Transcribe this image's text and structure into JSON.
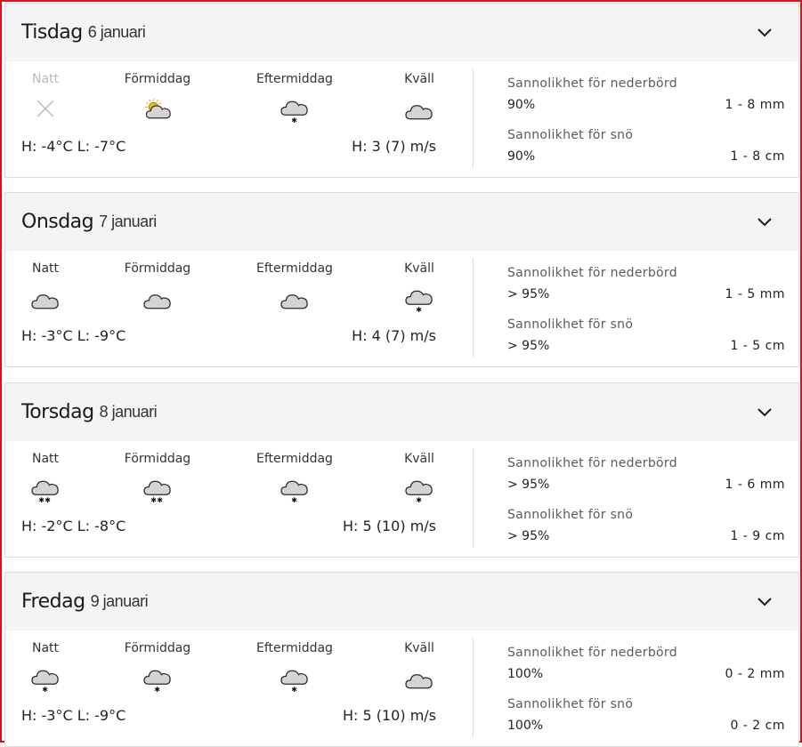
{
  "colors": {
    "frame_border": "#e0101a",
    "header_bg": "#f2f4f5",
    "cloud_fill": "#d4d4d4",
    "cloud_stroke": "#2a2a2a",
    "sun": "#f2b90c"
  },
  "days": [
    {
      "name": "Tisdag",
      "date": "6 januari",
      "periods": [
        {
          "label": "Natt",
          "icon": "unavailable-x-icon",
          "dim": true
        },
        {
          "label": "Förmiddag",
          "icon": "partly-cloudy-icon",
          "dim": false
        },
        {
          "label": "Eftermiddag",
          "icon": "cloud-light-snow-icon",
          "dim": false
        },
        {
          "label": "Kväll",
          "icon": "cloud-icon",
          "dim": false
        }
      ],
      "temps": "H: -4°C L: -7°C",
      "wind": "H: 3 (7) m/s",
      "precip_label": "Sannolikhet för nederbörd",
      "precip_pct": "90%",
      "precip_amt": "1 - 8 mm",
      "snow_label": "Sannolikhet för snö",
      "snow_pct": "90%",
      "snow_amt": "1 - 8 cm"
    },
    {
      "name": "Onsdag",
      "date": "7 januari",
      "periods": [
        {
          "label": "Natt",
          "icon": "cloud-icon",
          "dim": false
        },
        {
          "label": "Förmiddag",
          "icon": "cloud-icon",
          "dim": false
        },
        {
          "label": "Eftermiddag",
          "icon": "cloud-icon",
          "dim": false
        },
        {
          "label": "Kväll",
          "icon": "cloud-light-snow-icon",
          "dim": false
        }
      ],
      "temps": "H: -3°C L: -9°C",
      "wind": "H: 4 (7) m/s",
      "precip_label": "Sannolikhet för nederbörd",
      "precip_pct": "> 95%",
      "precip_amt": "1 - 5 mm",
      "snow_label": "Sannolikhet för snö",
      "snow_pct": "> 95%",
      "snow_amt": "1 - 5 cm"
    },
    {
      "name": "Torsdag",
      "date": "8 januari",
      "periods": [
        {
          "label": "Natt",
          "icon": "cloud-moderate-snow-icon",
          "dim": false
        },
        {
          "label": "Förmiddag",
          "icon": "cloud-moderate-snow-icon",
          "dim": false
        },
        {
          "label": "Eftermiddag",
          "icon": "cloud-light-snow-icon",
          "dim": false
        },
        {
          "label": "Kväll",
          "icon": "cloud-light-snow-icon",
          "dim": false
        }
      ],
      "temps": "H: -2°C L: -8°C",
      "wind": "H: 5 (10) m/s",
      "precip_label": "Sannolikhet för nederbörd",
      "precip_pct": "> 95%",
      "precip_amt": "1 - 6 mm",
      "snow_label": "Sannolikhet för snö",
      "snow_pct": "> 95%",
      "snow_amt": "1 - 9 cm"
    },
    {
      "name": "Fredag",
      "date": "9 januari",
      "periods": [
        {
          "label": "Natt",
          "icon": "cloud-light-snow-icon",
          "dim": false
        },
        {
          "label": "Förmiddag",
          "icon": "cloud-light-snow-icon",
          "dim": false
        },
        {
          "label": "Eftermiddag",
          "icon": "cloud-light-snow-icon",
          "dim": false
        },
        {
          "label": "Kväll",
          "icon": "cloud-icon",
          "dim": false
        }
      ],
      "temps": "H: -3°C L: -9°C",
      "wind": "H: 5 (10) m/s",
      "precip_label": "Sannolikhet för nederbörd",
      "precip_pct": "100%",
      "precip_amt": "0 - 2 mm",
      "snow_label": "Sannolikhet för snö",
      "snow_pct": "100%",
      "snow_amt": "0 - 2 cm"
    }
  ]
}
